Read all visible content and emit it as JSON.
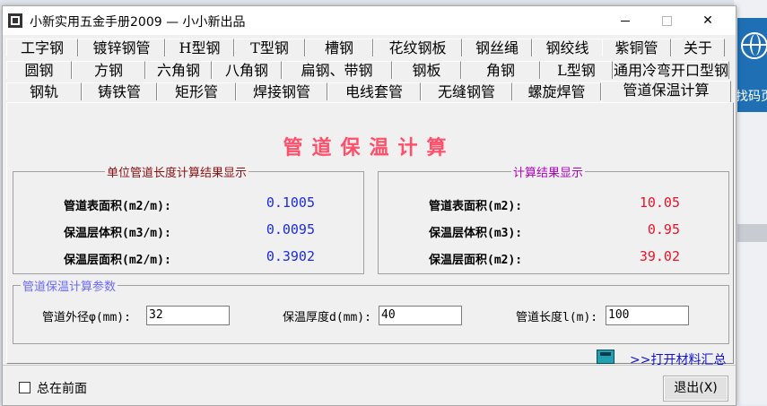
{
  "window": {
    "title": "小新实用五金手册2009 — 小小新出品"
  },
  "background": {
    "right_text": "找码页"
  },
  "tabs": {
    "row1": [
      "工字钢",
      "镀锌钢管",
      "H型钢",
      "T型钢",
      "槽钢",
      "花纹钢板",
      "钢丝绳",
      "钢绞线",
      "紫铜管",
      "关于"
    ],
    "row2": [
      "圆钢",
      "方钢",
      "六角钢",
      "八角钢",
      "扁钢、带钢",
      "钢板",
      "角钢",
      "L型钢",
      "通用冷弯开口型钢"
    ],
    "row3": [
      "钢轨",
      "铸铁管",
      "矩形管",
      "焊接钢管",
      "电线套管",
      "无缝钢管",
      "螺旋焊管",
      "管道保温计算"
    ],
    "active": "管道保温计算"
  },
  "page": {
    "title": "管道保温计算"
  },
  "unit_group": {
    "title": "单位管道长度计算结果显示",
    "rows": [
      {
        "label": "管道表面积(m2/m):",
        "value": "0.1005"
      },
      {
        "label": "保温层体积(m3/m):",
        "value": "0.0095"
      },
      {
        "label": "保温层面积(m2/m):",
        "value": "0.3902"
      }
    ]
  },
  "result_group": {
    "title": "计算结果显示",
    "rows": [
      {
        "label": "管道表面积(m2):",
        "value": "10.05"
      },
      {
        "label": "保温层体积(m3):",
        "value": "0.95"
      },
      {
        "label": "保温层面积(m2):",
        "value": "39.02"
      }
    ]
  },
  "params": {
    "title": "管道保温计算参数",
    "outer_diameter_label": "管道外径φ(mm):",
    "outer_diameter_value": "32",
    "thickness_label": "保温厚度d(mm):",
    "thickness_value": "40",
    "length_label": "管道长度l(m):",
    "length_value": "100"
  },
  "link": {
    "open_summary": ">>打开材料汇总"
  },
  "footer": {
    "always_on_top": "总在前面",
    "exit_button": "退出(X)"
  },
  "colors": {
    "title": "#ff4f6a",
    "unit_values": "#1c2be0",
    "result_values": "#e8142b",
    "result_group_title": "#b000c0",
    "unit_group_title": "#8b1010",
    "params_title": "#6a6aff"
  }
}
